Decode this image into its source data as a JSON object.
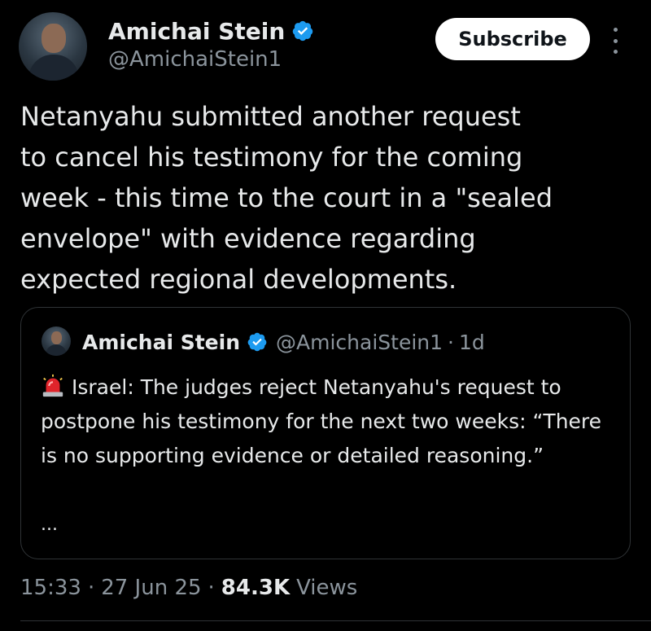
{
  "author": {
    "display_name": "Amichai Stein",
    "handle": "@AmichaiStein1",
    "verified": true
  },
  "header": {
    "subscribe_label": "Subscribe",
    "more_icon": "more-vertical-icon"
  },
  "tweet": {
    "text": "Netanyahu submitted another request\nto cancel his testimony for the coming\nweek - this time to the court in a \"sealed\nenvelope\" with evidence regarding\nexpected regional developments."
  },
  "quoted_tweet": {
    "display_name": "Amichai Stein",
    "handle": "@AmichaiStein1",
    "separator": "·",
    "time": "1d",
    "emoji_icon": "siren-icon",
    "text": "Israel: The judges reject Netanyahu's request to postpone his testimony for the next two weeks: “There is no supporting evidence or detailed reasoning.”",
    "ellipsis": "..."
  },
  "meta": {
    "time": "15:33",
    "date": "27 Jun 25",
    "separator": "·",
    "views_count": "84.3K",
    "views_label": "Views"
  },
  "colors": {
    "background": "#000000",
    "text": "#e7e9ea",
    "secondary": "#8b949c",
    "verified_blue": "#1d9bf0",
    "border": "#2f3336"
  }
}
